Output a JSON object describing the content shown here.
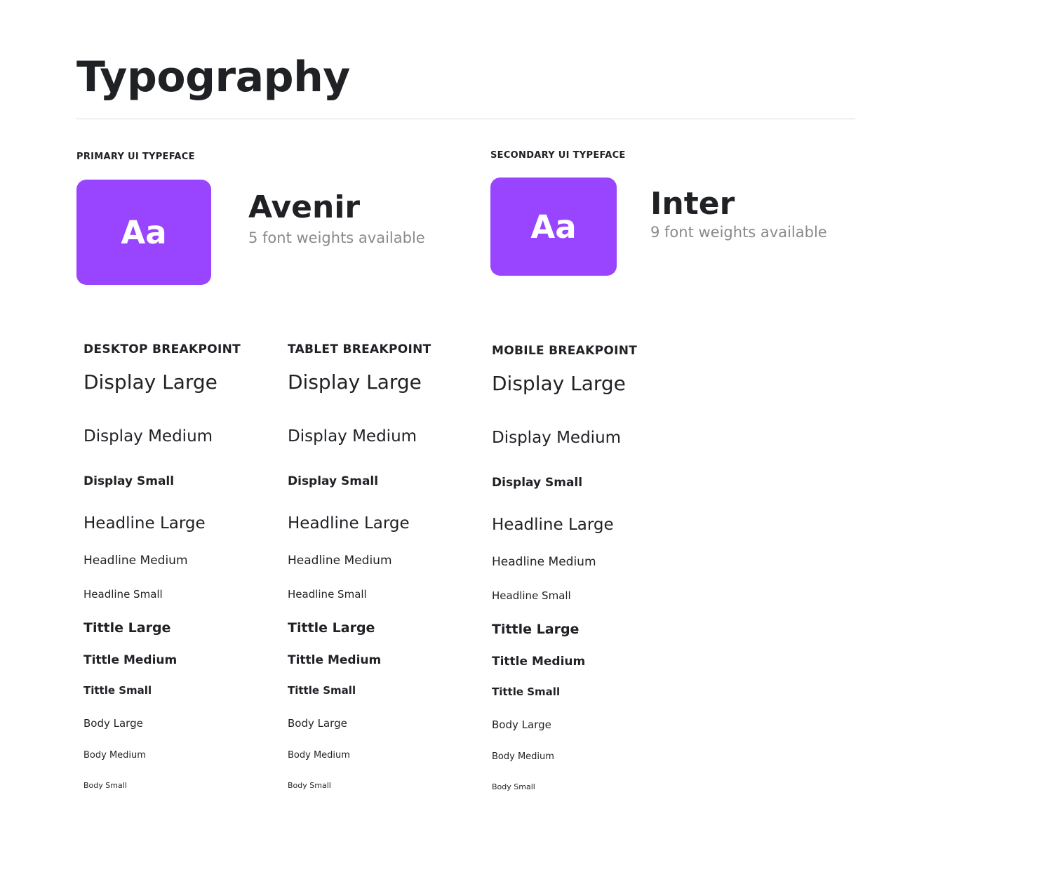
{
  "page": {
    "title": "Typography"
  },
  "colors": {
    "swatch": "#9945ff",
    "text": "#1f2125",
    "muted": "#8a8a8a",
    "divider": "#d9d9d9"
  },
  "typefaces": {
    "primary": {
      "label": "PRIMARY UI TYPEFACE",
      "sample": "Aa",
      "name": "Avenir",
      "weights": "5 font weights available"
    },
    "secondary": {
      "label": "SECONDARY UI TYPEFACE",
      "sample": "Aa",
      "name": "Inter",
      "weights": "9 font weights available"
    }
  },
  "breakpoints": {
    "desktop": {
      "heading": "DESKTOP BREAKPOINT",
      "styles": {
        "display_large": "Display Large",
        "display_medium": "Display Medium",
        "display_small": "Display Small",
        "headline_large": "Headline Large",
        "headline_medium": "Headline Medium",
        "headline_small": "Headline Small",
        "title_large": "Tittle Large",
        "title_medium": "Tittle Medium",
        "title_small": "Tittle Small",
        "body_large": "Body Large",
        "body_medium": "Body Medium",
        "body_small": "Body Small"
      }
    },
    "tablet": {
      "heading": "TABLET BREAKPOINT",
      "styles": {
        "display_large": "Display Large",
        "display_medium": "Display Medium",
        "display_small": "Display Small",
        "headline_large": "Headline Large",
        "headline_medium": "Headline Medium",
        "headline_small": "Headline Small",
        "title_large": "Tittle Large",
        "title_medium": "Tittle Medium",
        "title_small": "Tittle Small",
        "body_large": "Body Large",
        "body_medium": "Body Medium",
        "body_small": "Body Small"
      }
    },
    "mobile": {
      "heading": "MOBILE BREAKPOINT",
      "styles": {
        "display_large": "Display Large",
        "display_medium": "Display Medium",
        "display_small": "Display Small",
        "headline_large": "Headline Large",
        "headline_medium": "Headline Medium",
        "headline_small": "Headline Small",
        "title_large": "Tittle Large",
        "title_medium": "Tittle Medium",
        "title_small": "Tittle Small",
        "body_large": "Body Large",
        "body_medium": "Body Medium",
        "body_small": "Body Small"
      }
    }
  }
}
